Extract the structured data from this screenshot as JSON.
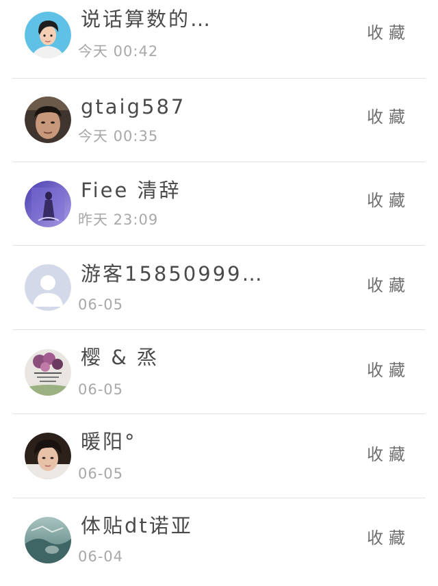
{
  "contacts": [
    {
      "name": "说话算数的…",
      "time": "今天 00:42",
      "action": "收藏",
      "avatar_icon": "woman-portrait-avatar",
      "avatar_color": "#5fc1e6"
    },
    {
      "name": "gtaig587",
      "time": "今天 00:35",
      "action": "收藏",
      "avatar_icon": "man-photo-avatar",
      "avatar_color": "#5b4a3f"
    },
    {
      "name": "Fiee 清辞",
      "time": "昨天 23:09",
      "action": "收藏",
      "avatar_icon": "purple-figure-avatar",
      "avatar_color": "#6a5bc7"
    },
    {
      "name": "游客15850999…",
      "time": "06-05",
      "action": "收藏",
      "avatar_icon": "default-user-avatar",
      "avatar_color": "#d3d9e8"
    },
    {
      "name": "樱 & 烝",
      "time": "06-05",
      "action": "收藏",
      "avatar_icon": "flower-avatar",
      "avatar_color": "#8a4f7b"
    },
    {
      "name": "暖阳°",
      "time": "06-05",
      "action": "收藏",
      "avatar_icon": "boy-photo-avatar",
      "avatar_color": "#3b2a22"
    },
    {
      "name": "体贴dt诺亚",
      "time": "06-04",
      "action": "收藏",
      "avatar_icon": "landscape-avatar",
      "avatar_color": "#6f9a9a"
    }
  ]
}
